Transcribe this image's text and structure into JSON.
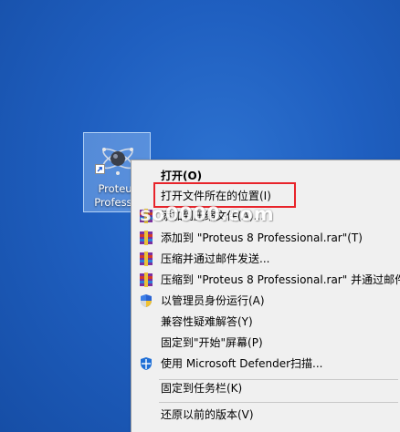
{
  "desktop_icon": {
    "label_line1": "Proteus",
    "label_line2": "Professio"
  },
  "watermark": "so0000.com",
  "highlight_color": "#e8232a",
  "context_menu": {
    "items": [
      {
        "label": "打开(O)",
        "icon": "none",
        "bold": true
      },
      {
        "label": "打开文件所在的位置(I)",
        "icon": "none",
        "bold": false
      },
      {
        "label": "添加到压缩文件(A)...",
        "icon": "rar-icon",
        "bold": false
      },
      {
        "label": "添加到 \"Proteus 8 Professional.rar\"(T)",
        "icon": "rar-icon",
        "bold": false
      },
      {
        "label": "压缩并通过邮件发送...",
        "icon": "rar-icon",
        "bold": false
      },
      {
        "label": "压缩到 \"Proteus 8 Professional.rar\" 并通过邮件",
        "icon": "rar-icon",
        "bold": false
      },
      {
        "label": "以管理员身份运行(A)",
        "icon": "uac-shield-icon",
        "bold": false
      },
      {
        "label": "兼容性疑难解答(Y)",
        "icon": "none",
        "bold": false
      },
      {
        "label": "固定到\"开始\"屏幕(P)",
        "icon": "none",
        "bold": false
      },
      {
        "label": "使用 Microsoft Defender扫描...",
        "icon": "defender-icon",
        "bold": false
      },
      {
        "label": "固定到任务栏(K)",
        "icon": "none",
        "bold": false
      },
      {
        "label": "还原以前的版本(V)",
        "icon": "none",
        "bold": false
      }
    ]
  }
}
